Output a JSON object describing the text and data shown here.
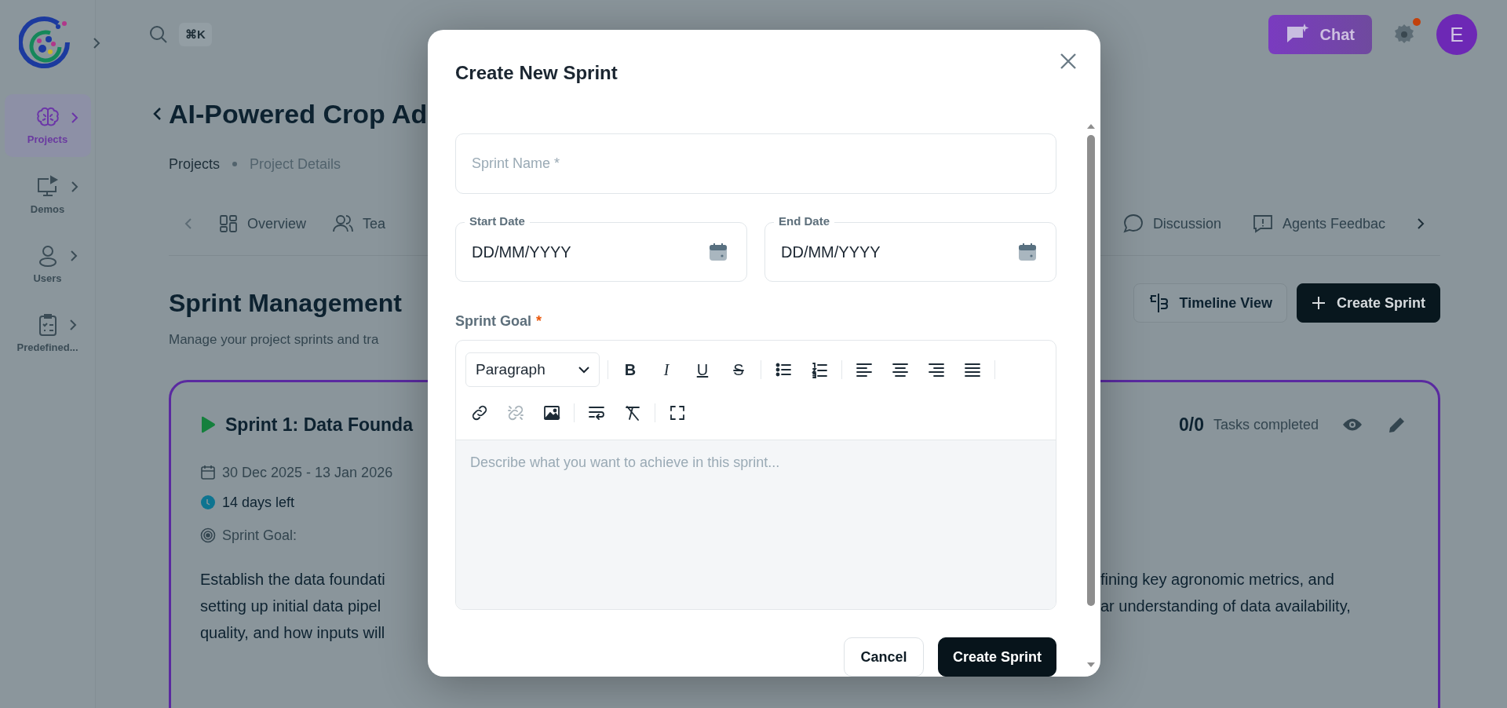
{
  "sidebar": {
    "items": [
      {
        "label": "Projects",
        "selected": true
      },
      {
        "label": "Demos",
        "selected": false
      },
      {
        "label": "Users",
        "selected": false
      },
      {
        "label": "Predefined...",
        "selected": false
      }
    ]
  },
  "topbar": {
    "shortcut": "⌘K",
    "chat": "Chat",
    "settings_notification": true,
    "avatar": "E"
  },
  "project": {
    "title": "AI-Powered Crop Ad",
    "breadcrumbs": [
      {
        "label": "Projects",
        "current": false
      },
      {
        "label": "Project Details",
        "current": true
      }
    ],
    "tabs": [
      {
        "label": "Overview"
      },
      {
        "label": "Tea"
      },
      {
        "label": "Discussion"
      },
      {
        "label": "Agents Feedbac"
      }
    ]
  },
  "sprints": {
    "title": "Sprint Management",
    "subtitle": "Manage your project sprints and tra",
    "buttons": [
      {
        "kind": "secondary",
        "label": "Timeline View"
      },
      {
        "kind": "primary",
        "label": "Create Sprint"
      }
    ],
    "cards": [
      {
        "title": "Sprint 1: Data Founda",
        "tasks_count": "0/0",
        "tasks_label": "Tasks completed",
        "dates": "30 Dec 2025 - 13 Jan 2026",
        "days_left": "14 days left",
        "goal_label": "Sprint Goal:",
        "goal_left": [
          "Establish the data foundati",
          "setting up initial data pipel",
          "quality, and how inputs will"
        ],
        "goal_right": [
          "fining key agronomic metrics, and",
          "ar understanding of data availability,"
        ]
      }
    ]
  },
  "dialog": {
    "title": "Create New Sprint",
    "name_field": {
      "placeholder": "Sprint Name *"
    },
    "date_fields": [
      {
        "label": "Start Date",
        "placeholder": "DD/MM/YYYY"
      },
      {
        "label": "End Date",
        "placeholder": "DD/MM/YYYY"
      }
    ],
    "goal": {
      "label": "Sprint Goal",
      "required_mark": "*",
      "block_format": "Paragraph",
      "placeholder": "Describe what you want to achieve in this sprint...",
      "tool_groups": [
        [
          {
            "kind": "bold",
            "label": "B",
            "disabled": false
          },
          {
            "kind": "italic",
            "label": "I",
            "disabled": false
          },
          {
            "kind": "underline",
            "label": "U",
            "disabled": false
          },
          {
            "kind": "strike",
            "label": "S",
            "disabled": false
          }
        ],
        [
          {
            "kind": "bullets",
            "disabled": false
          },
          {
            "kind": "numbers",
            "disabled": false
          }
        ],
        [
          {
            "kind": "align-left",
            "disabled": false
          },
          {
            "kind": "align-center",
            "disabled": false
          },
          {
            "kind": "align-right",
            "disabled": false
          },
          {
            "kind": "justify",
            "disabled": false
          }
        ],
        [
          {
            "kind": "link",
            "disabled": false
          },
          {
            "kind": "unlink",
            "disabled": true
          },
          {
            "kind": "image",
            "disabled": false
          }
        ],
        [
          {
            "kind": "wrap",
            "disabled": false
          },
          {
            "kind": "clear-format",
            "disabled": false
          }
        ],
        [
          {
            "kind": "fullscreen",
            "disabled": false
          }
        ]
      ]
    },
    "buttons": [
      {
        "kind": "secondary",
        "label": "Cancel"
      },
      {
        "kind": "primary",
        "label": "Create Sprint"
      }
    ]
  }
}
